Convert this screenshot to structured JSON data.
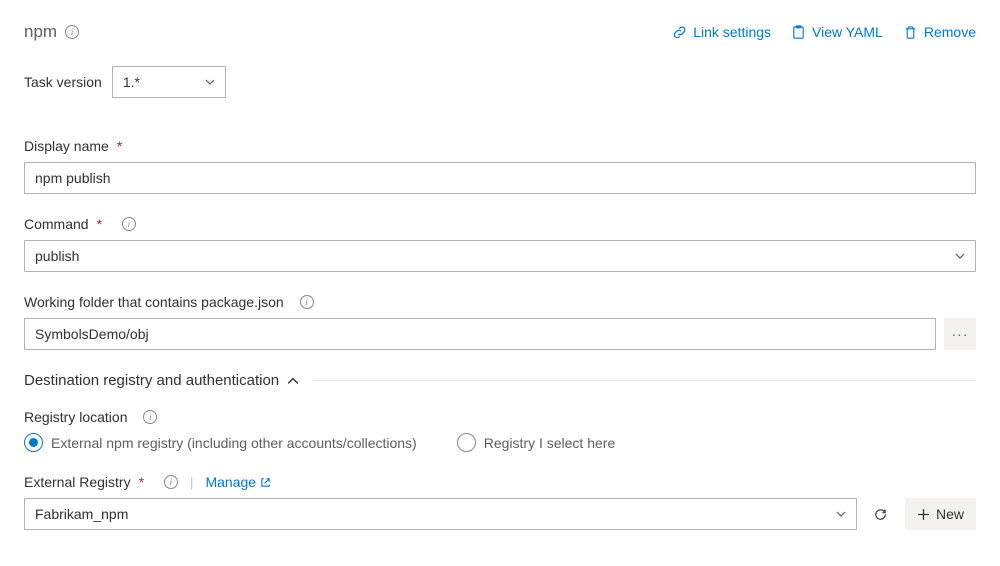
{
  "header": {
    "title": "npm",
    "links": {
      "link_settings": "Link settings",
      "view_yaml": "View YAML",
      "remove": "Remove"
    }
  },
  "task_version": {
    "label": "Task version",
    "value": "1.*"
  },
  "display_name": {
    "label": "Display name",
    "value": "npm publish"
  },
  "command": {
    "label": "Command",
    "value": "publish"
  },
  "working_folder": {
    "label": "Working folder that contains package.json",
    "value": "SymbolsDemo/obj"
  },
  "section": {
    "title": "Destination registry and authentication"
  },
  "registry_location": {
    "label": "Registry location",
    "options": {
      "external": "External npm registry (including other accounts/collections)",
      "select_here": "Registry I select here"
    },
    "selected": "external"
  },
  "external_registry": {
    "label": "External Registry",
    "manage_label": "Manage",
    "value": "Fabrikam_npm",
    "new_label": "New"
  }
}
